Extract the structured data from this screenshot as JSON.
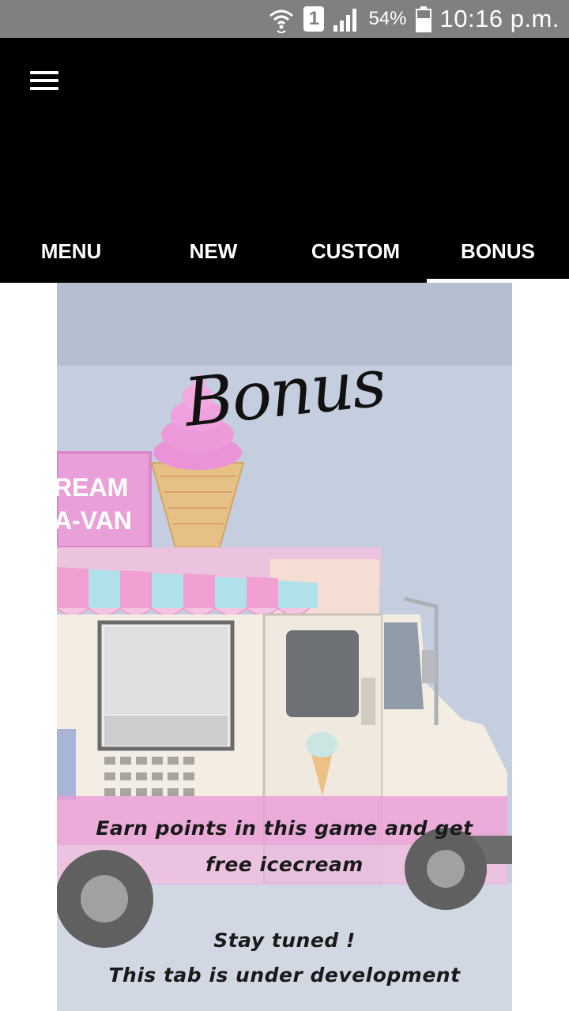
{
  "status_bar": {
    "sim": "1",
    "battery": "54%",
    "time": "10:16 p.m."
  },
  "tabs": [
    {
      "label": "MENU",
      "active": false
    },
    {
      "label": "NEW",
      "active": false
    },
    {
      "label": "CUSTOM",
      "active": false
    },
    {
      "label": "BONUS",
      "active": true
    }
  ],
  "bonus": {
    "title": "Bonus",
    "truck_sign": [
      "REAM",
      "A-VAN"
    ],
    "line1": "Earn points in this  game and get",
    "line2": "free icecream",
    "line3": "Stay tuned !",
    "line4": "This tab is under development"
  },
  "colors": {
    "status_bar": "#808080",
    "app_bar": "#000000",
    "accent_pink": "#e58cd0",
    "awning_blue": "#9fdbe6"
  }
}
